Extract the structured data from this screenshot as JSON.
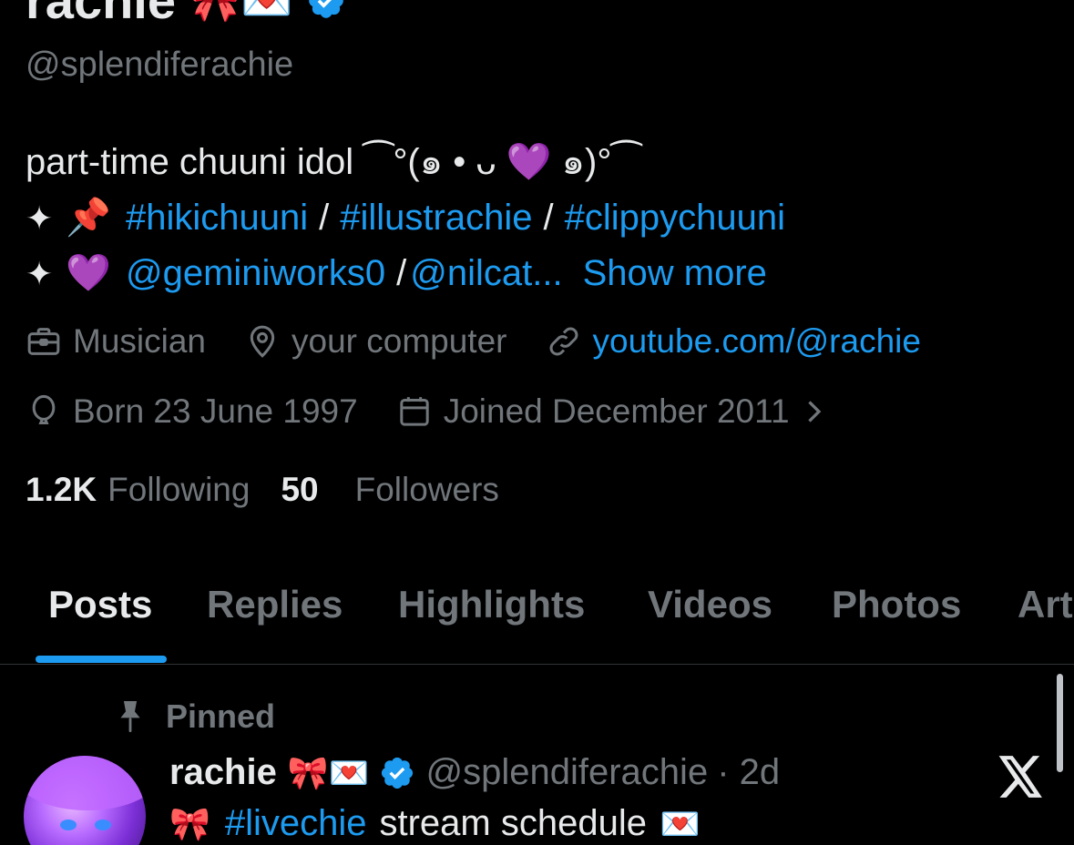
{
  "profile": {
    "display_name": "rachie",
    "name_emojis": "🎀💌",
    "handle": "@splendiferachie",
    "bio": {
      "line1": "part-time chuuni idol ⁀°(๑ • ᴗ 💜 ๑)°⁀",
      "line2": {
        "sparkle": "✦",
        "emoji": "📌",
        "tag1": "#hikichuuni",
        "sep1": "/",
        "tag2": "#illustrachie",
        "sep2": "/",
        "tag3": "#clippychuuni"
      },
      "line3": {
        "sparkle": "✦",
        "emoji": "💜",
        "mention1": "@geminiworks0",
        "sep": "/",
        "mention2": "@nilcat...",
        "show_more": "Show more"
      }
    },
    "meta": {
      "category": "Musician",
      "location": "your computer",
      "website": "youtube.com/@rachie",
      "born": "Born 23 June 1997",
      "joined": "Joined December 2011"
    },
    "stats": {
      "following_count": "1.2K",
      "following_label": "Following",
      "followers_count": "50",
      "followers_label": "Followers"
    }
  },
  "tabs": [
    {
      "label": "Posts",
      "active": true
    },
    {
      "label": "Replies"
    },
    {
      "label": "Highlights"
    },
    {
      "label": "Videos"
    },
    {
      "label": "Photos"
    },
    {
      "label": "Art"
    }
  ],
  "pinned_post": {
    "pinned_label": "Pinned",
    "author_name": "rachie",
    "author_emojis": "🎀💌",
    "author_handle": "@splendiferachie",
    "time": "· 2d",
    "text_emoji": "🎀",
    "text_tag": "#livechie",
    "text_body": "stream schedule",
    "text_end_emoji": "💌"
  },
  "colors": {
    "background": "#000000",
    "text_primary": "#e7e9ea",
    "text_secondary": "#71767b",
    "accent_blue": "#1d9bf0",
    "divider": "#2f3336"
  },
  "icons": [
    "briefcase-icon",
    "location-pin-icon",
    "link-icon",
    "birthday-balloon-icon",
    "calendar-icon",
    "chevron-right-icon",
    "pin-icon",
    "verified-badge-icon",
    "x-logo-icon"
  ]
}
